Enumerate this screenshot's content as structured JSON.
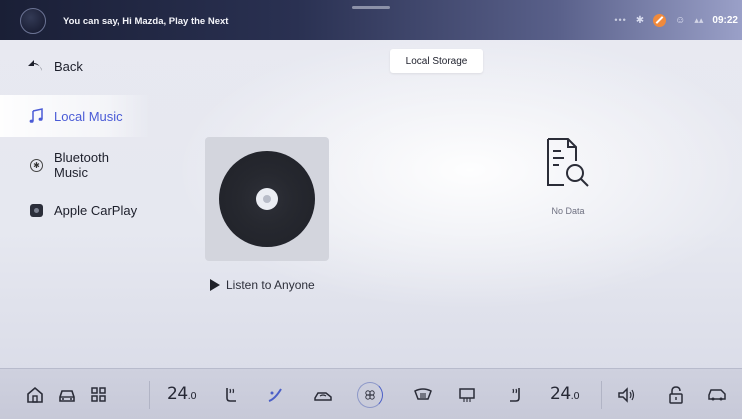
{
  "status_bar": {
    "voice_hint": "You can say, Hi Mazda, Play the Next",
    "clock": "09:22",
    "icons": [
      "more-dots-icon",
      "bluetooth-icon",
      "mute-icon",
      "user-icon",
      "signal-icon"
    ]
  },
  "sidebar": {
    "back_label": "Back",
    "items": [
      {
        "label": "Local Music",
        "icon": "music-note-icon",
        "active": true
      },
      {
        "label": "Bluetooth Music",
        "icon": "bluetooth-icon",
        "active": false
      },
      {
        "label": "Apple CarPlay",
        "icon": "carplay-icon",
        "active": false
      }
    ]
  },
  "main": {
    "tab_label": "Local Storage",
    "listen_label": "Listen to Anyone",
    "no_data_label": "No Data"
  },
  "dock": {
    "left_temp": {
      "value": "24",
      "decimal": ".0"
    },
    "right_temp": {
      "value": "24",
      "decimal": ".0"
    },
    "icons": [
      "home-icon",
      "car-icon",
      "apps-grid-icon",
      "seat-heat-left-icon",
      "airflow-icon",
      "recirculation-icon",
      "fan-icon",
      "front-defrost-icon",
      "rear-defrost-icon",
      "seat-heat-right-icon",
      "volume-icon",
      "lock-icon",
      "car-settings-icon"
    ],
    "accent": "#4b5fc7"
  },
  "colors": {
    "accent": "#4a5bd6",
    "mute_badge": "#f08a3c"
  }
}
